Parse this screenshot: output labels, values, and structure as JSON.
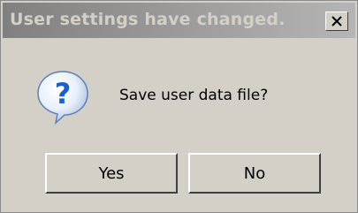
{
  "dialog": {
    "title": "User settings have changed.",
    "message": "Save user data file?",
    "icon": "question-icon",
    "close_icon": "close-icon",
    "buttons": {
      "yes_label": "Yes",
      "no_label": "No"
    }
  },
  "colors": {
    "titlebar_start": "#808080",
    "titlebar_end": "#b5b5b5",
    "title_text": "#d4d0c8",
    "face": "#d4d0c8",
    "icon_blue": "#1a5fcf"
  }
}
